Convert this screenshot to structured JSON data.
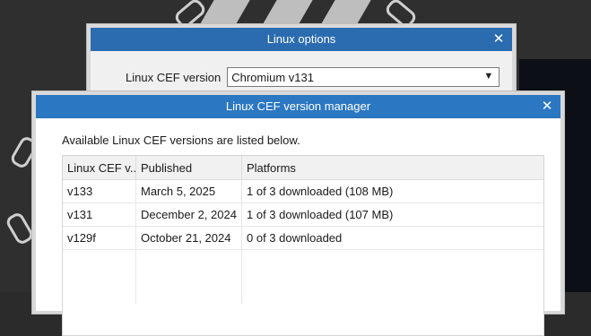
{
  "linux_options_window": {
    "title": "Linux options",
    "cef_version_label": "Linux CEF version",
    "cef_version_selected": "Chromium v131"
  },
  "cef_manager_window": {
    "title": "Linux CEF version manager",
    "description": "Available Linux CEF versions are listed below.",
    "columns": [
      "Linux CEF v...",
      "Published",
      "Platforms"
    ],
    "rows": [
      {
        "version": "v133",
        "published": "March 5, 2025",
        "platforms": "1 of 3 downloaded (108 MB)"
      },
      {
        "version": "v131",
        "published": "December 2, 2024",
        "platforms": "1 of 3 downloaded (107 MB)"
      },
      {
        "version": "v129f",
        "published": "October 21, 2024",
        "platforms": "0 of 3 downloaded"
      }
    ]
  },
  "icons": {
    "close": "close-icon",
    "dropdown": "chevron-down-icon"
  },
  "colors": {
    "titlebar": "#2b77c2",
    "window_bg": "#f0f0f0"
  }
}
